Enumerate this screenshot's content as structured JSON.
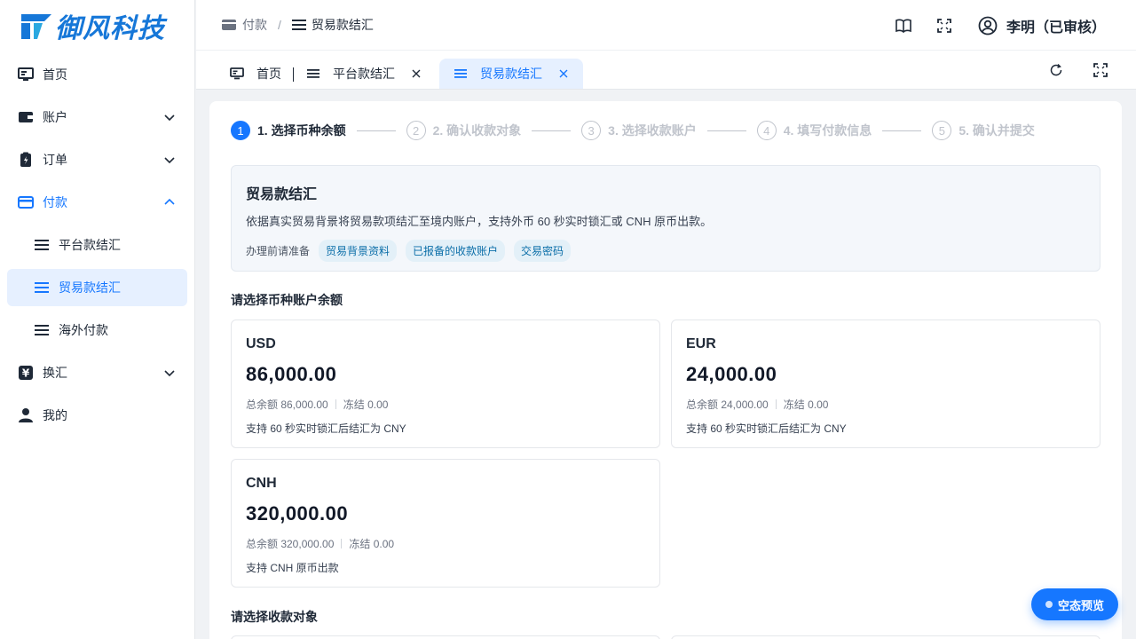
{
  "brand": {
    "name": "御风科技",
    "color": "#1677d8"
  },
  "accent": "#1677ff",
  "sidebar": {
    "items": [
      {
        "label": "首页",
        "icon": "dashboard-icon"
      },
      {
        "label": "账户",
        "icon": "wallet-icon"
      },
      {
        "label": "订单",
        "icon": "order-icon"
      },
      {
        "label": "付款",
        "icon": "card-icon"
      },
      {
        "label": "平台款结汇",
        "icon": "list-icon"
      },
      {
        "label": "贸易款结汇",
        "icon": "list-icon"
      },
      {
        "label": "海外付款",
        "icon": "list-icon"
      },
      {
        "label": "换汇",
        "icon": "exchange-icon"
      },
      {
        "label": "我的",
        "icon": "user-icon"
      }
    ]
  },
  "header": {
    "breadcrumb": {
      "parent": "付款",
      "current": "贸易款结汇"
    },
    "user": "李明（已审核）"
  },
  "tabs": [
    {
      "label": "首页"
    },
    {
      "label": "平台款结汇"
    },
    {
      "label": "贸易款结汇"
    }
  ],
  "steps": [
    {
      "num": "1",
      "label": "1. 选择币种余额"
    },
    {
      "num": "2",
      "label": "2. 确认收款对象"
    },
    {
      "num": "3",
      "label": "3. 选择收款账户"
    },
    {
      "num": "4",
      "label": "4. 填写付款信息"
    },
    {
      "num": "5",
      "label": "5. 确认并提交"
    }
  ],
  "intro": {
    "title": "贸易款结汇",
    "desc": "依据真实贸易背景将贸易款项结汇至境内账户，支持外币 60 秒实时锁汇或 CNH 原币出款。",
    "prep_label": "办理前请准备",
    "chips": [
      "贸易背景资料",
      "已报备的收款账户",
      "交易密码"
    ]
  },
  "balance_section_title": "请选择币种账户余额",
  "balances": [
    {
      "currency": "USD",
      "amount": "86,000.00",
      "total": "总余额 86,000.00",
      "frozen": "冻结 0.00",
      "note": "支持 60 秒实时锁汇后结汇为 CNY"
    },
    {
      "currency": "EUR",
      "amount": "24,000.00",
      "total": "总余额 24,000.00",
      "frozen": "冻结 0.00",
      "note": "支持 60 秒实时锁汇后结汇为 CNY"
    },
    {
      "currency": "CNH",
      "amount": "320,000.00",
      "total": "总余额 320,000.00",
      "frozen": "冻结 0.00",
      "note": "支持 CNH 原币出款"
    }
  ],
  "payee_section_title": "请选择收款对象",
  "fab_label": "空态预览"
}
